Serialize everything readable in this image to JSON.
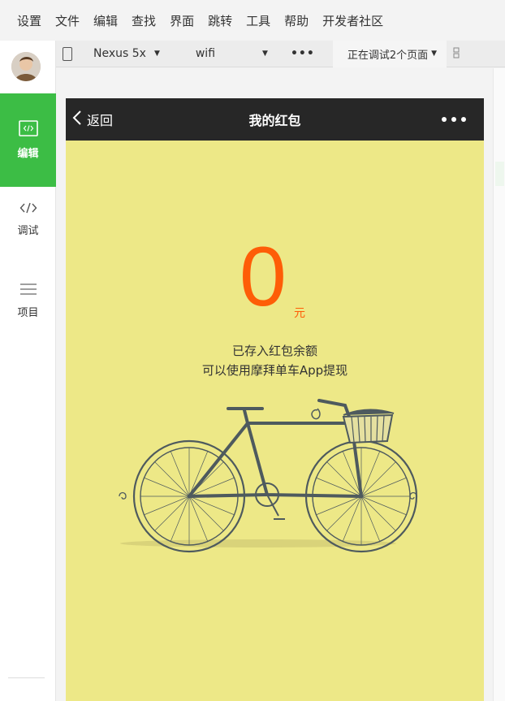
{
  "menu": [
    "设置",
    "文件",
    "编辑",
    "查找",
    "界面",
    "跳转",
    "工具",
    "帮助",
    "开发者社区"
  ],
  "sidebar": {
    "items": [
      {
        "label": "编辑",
        "icon": "code-window-icon",
        "active": true
      },
      {
        "label": "调试",
        "icon": "code-brackets-icon",
        "active": false
      },
      {
        "label": "项目",
        "icon": "menu-lines-icon",
        "active": false
      }
    ]
  },
  "toolbar": {
    "device": "Nexus 5x",
    "network": "wifi",
    "more": "•••",
    "status": "正在调试2个页面"
  },
  "page": {
    "nav_back": "返回",
    "nav_title": "我的红包",
    "amount": "0",
    "unit": "元",
    "desc_line1": "已存入红包余额",
    "desc_line2": "可以使用摩拜单车App提现"
  },
  "colors": {
    "accent_green": "#3cbd45",
    "amount_orange": "#fe5d07",
    "page_bg": "#ede887",
    "navbar_bg": "#272727"
  }
}
